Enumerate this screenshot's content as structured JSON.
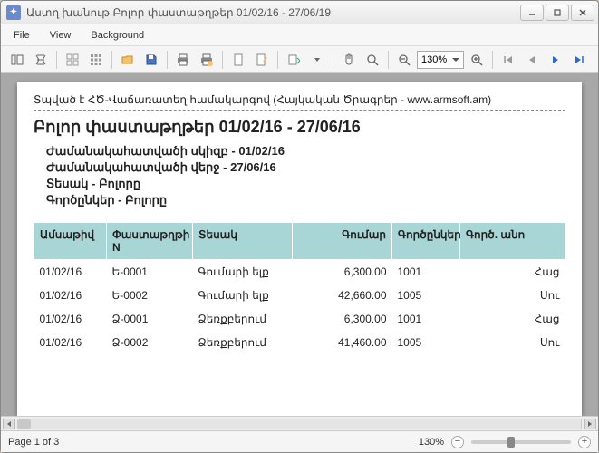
{
  "window": {
    "title": "Աստղ խանութ Բոլոր փաստաթղթեր 01/02/16 - 27/06/19"
  },
  "menu": {
    "file": "File",
    "view": "View",
    "background": "Background"
  },
  "toolbar": {
    "zoom_select": "130%"
  },
  "doc": {
    "printline": "Տպված է ՀԾ-Վաճառատեղ համակարգով (Հայկական Ծրագրեր - www.armsoft.am)",
    "title": "Բոլոր փաստաթղթեր 01/02/16 - 27/06/16",
    "period_start": "Ժամանակահատվածի սկիզբ - 01/02/16",
    "period_end": "Ժամանակահատվածի վերջ  - 27/06/16",
    "kind": "Տեսակ - Բոլորը",
    "partners": "Գործընկեր - Բոլորը",
    "headers": {
      "date": "Ամսաթիվ",
      "docno": "Փաստաթղթի N",
      "type": "Տեսակ",
      "amount": "Գումար",
      "partner": "Գործընկեր",
      "partner_name": "Գործ. անո"
    },
    "rows": [
      {
        "date": "01/02/16",
        "docno": "Ե-0001",
        "type": "Գումարի ելք",
        "amount": "6,300.00",
        "partner": "1001",
        "pname": "Հաց"
      },
      {
        "date": "01/02/16",
        "docno": "Ե-0002",
        "type": "Գումարի ելք",
        "amount": "42,660.00",
        "partner": "1005",
        "pname": "Սու"
      },
      {
        "date": "01/02/16",
        "docno": "Ձ-0001",
        "type": "Ձեռքբերում",
        "amount": "6,300.00",
        "partner": "1001",
        "pname": "Հաց"
      },
      {
        "date": "01/02/16",
        "docno": "Ձ-0002",
        "type": "Ձեռքբերում",
        "amount": "41,460.00",
        "partner": "1005",
        "pname": "Սու"
      }
    ]
  },
  "status": {
    "page": "Page 1 of 3",
    "zoom": "130%"
  }
}
